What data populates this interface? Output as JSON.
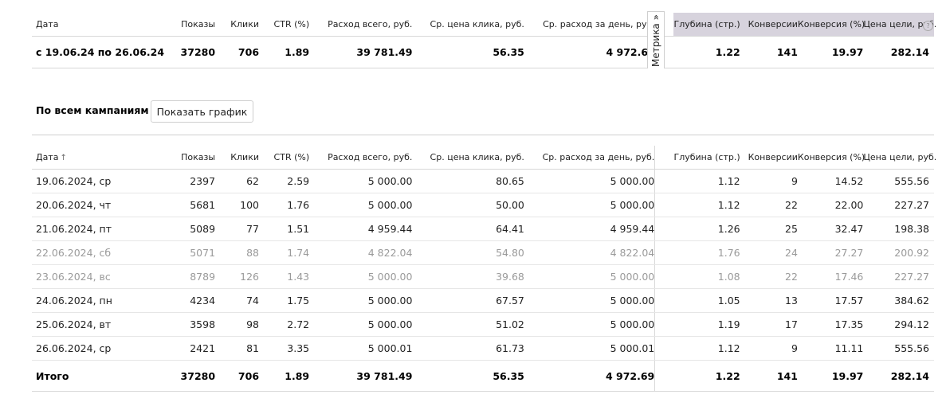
{
  "columns": {
    "date": "Дата",
    "shows": "Показы",
    "clicks": "Клики",
    "ctr": "CTR (%)",
    "spend_total": "Расход всего, руб.",
    "avg_click": "Ср. цена клика, руб.",
    "avg_day": "Ср. расход за день, руб.",
    "depth": "Глубина (стр.)",
    "conversions": "Конверсии",
    "conv_rate": "Конверсия (%)",
    "goal_price": "Цена цели, руб."
  },
  "summary": {
    "period": "с 19.06.24 по 26.06.24",
    "shows": "37280",
    "clicks": "706",
    "ctr": "1.89",
    "spend_total": "39 781.49",
    "avg_click": "56.35",
    "avg_day": "4 972.69",
    "depth": "1.22",
    "conversions": "141",
    "conv_rate": "19.97",
    "goal_price": "282.14"
  },
  "metrika_tab_label": "Метрика »",
  "help_icon": "?",
  "section_title": "По всем кампаниям",
  "show_chart_button": "Показать график",
  "sort_icon": "↑",
  "rows": [
    {
      "date": "19.06.2024, ср",
      "shows": "2397",
      "clicks": "62",
      "ctr": "2.59",
      "spend_total": "5 000.00",
      "avg_click": "80.65",
      "avg_day": "5 000.00",
      "depth": "1.12",
      "conversions": "9",
      "conv_rate": "14.52",
      "goal_price": "555.56"
    },
    {
      "date": "20.06.2024, чт",
      "shows": "5681",
      "clicks": "100",
      "ctr": "1.76",
      "spend_total": "5 000.00",
      "avg_click": "50.00",
      "avg_day": "5 000.00",
      "depth": "1.12",
      "conversions": "22",
      "conv_rate": "22.00",
      "goal_price": "227.27"
    },
    {
      "date": "21.06.2024, пт",
      "shows": "5089",
      "clicks": "77",
      "ctr": "1.51",
      "spend_total": "4 959.44",
      "avg_click": "64.41",
      "avg_day": "4 959.44",
      "depth": "1.26",
      "conversions": "25",
      "conv_rate": "32.47",
      "goal_price": "198.38"
    },
    {
      "date": "22.06.2024, сб",
      "shows": "5071",
      "clicks": "88",
      "ctr": "1.74",
      "spend_total": "4 822.04",
      "avg_click": "54.80",
      "avg_day": "4 822.04",
      "depth": "1.76",
      "conversions": "24",
      "conv_rate": "27.27",
      "goal_price": "200.92"
    },
    {
      "date": "23.06.2024, вс",
      "shows": "8789",
      "clicks": "126",
      "ctr": "1.43",
      "spend_total": "5 000.00",
      "avg_click": "39.68",
      "avg_day": "5 000.00",
      "depth": "1.08",
      "conversions": "22",
      "conv_rate": "17.46",
      "goal_price": "227.27"
    },
    {
      "date": "24.06.2024, пн",
      "shows": "4234",
      "clicks": "74",
      "ctr": "1.75",
      "spend_total": "5 000.00",
      "avg_click": "67.57",
      "avg_day": "5 000.00",
      "depth": "1.05",
      "conversions": "13",
      "conv_rate": "17.57",
      "goal_price": "384.62"
    },
    {
      "date": "25.06.2024, вт",
      "shows": "3598",
      "clicks": "98",
      "ctr": "2.72",
      "spend_total": "5 000.00",
      "avg_click": "51.02",
      "avg_day": "5 000.00",
      "depth": "1.19",
      "conversions": "17",
      "conv_rate": "17.35",
      "goal_price": "294.12"
    },
    {
      "date": "26.06.2024, ср",
      "shows": "2421",
      "clicks": "81",
      "ctr": "3.35",
      "spend_total": "5 000.01",
      "avg_click": "61.73",
      "avg_day": "5 000.01",
      "depth": "1.12",
      "conversions": "9",
      "conv_rate": "11.11",
      "goal_price": "555.56"
    }
  ],
  "totals": {
    "label": "Итого",
    "shows": "37280",
    "clicks": "706",
    "ctr": "1.89",
    "spend_total": "39 781.49",
    "avg_click": "56.35",
    "avg_day": "4 972.69",
    "depth": "1.22",
    "conversions": "141",
    "conv_rate": "19.97",
    "goal_price": "282.14"
  }
}
